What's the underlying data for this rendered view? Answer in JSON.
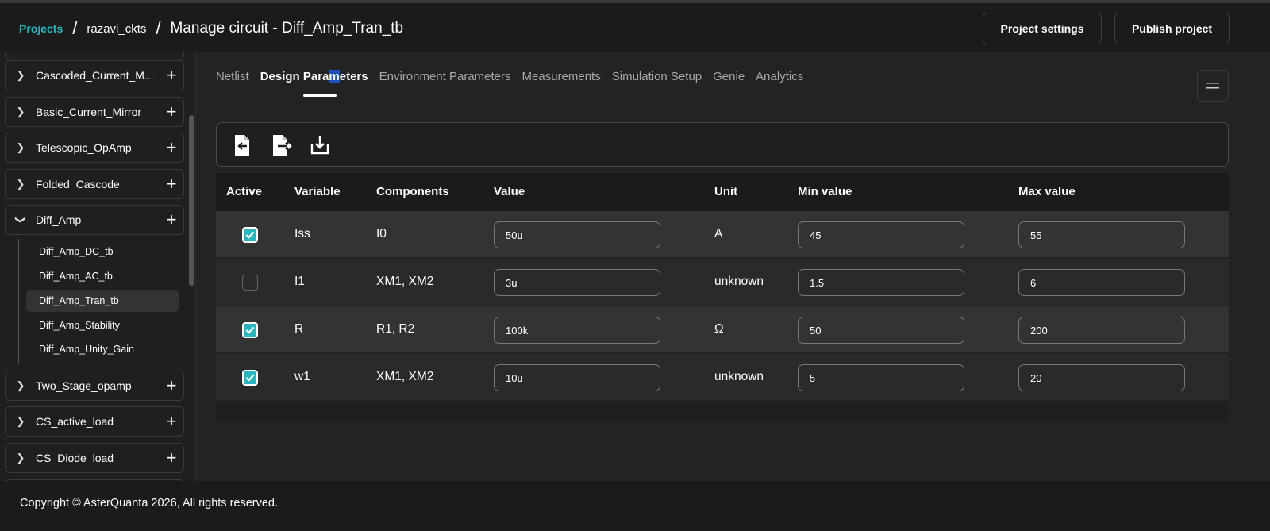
{
  "breadcrumb": {
    "projects": "Projects",
    "project": "razavi_ckts",
    "title": "Manage circuit - Diff_Amp_Tran_tb",
    "separator": "/"
  },
  "header_buttons": {
    "settings": "Project settings",
    "publish": "Publish project"
  },
  "sidebar": {
    "groups_top": [
      {
        "label": "Cascoded_Current_M..."
      },
      {
        "label": "Basic_Current_Mirror"
      },
      {
        "label": "Telescopic_OpAmp"
      },
      {
        "label": "Folded_Cascode"
      },
      {
        "label": "Diff_Amp"
      }
    ],
    "subitems": [
      {
        "label": "Diff_Amp_DC_tb"
      },
      {
        "label": "Diff_Amp_AC_tb"
      },
      {
        "label": "Diff_Amp_Tran_tb"
      },
      {
        "label": "Diff_Amp_Stability"
      },
      {
        "label": "Diff_Amp_Unity_Gain"
      }
    ],
    "groups_bottom": [
      {
        "label": "Two_Stage_opamp"
      },
      {
        "label": "CS_active_load"
      },
      {
        "label": "CS_Diode_load"
      }
    ]
  },
  "tabs": {
    "netlist": "Netlist",
    "design_a": "Design Para",
    "design_hl": "m",
    "design_b": "eters",
    "environment": "Environment Parameters",
    "measurements": "Measurements",
    "simulation": "Simulation Setup",
    "genie": "Genie",
    "analytics": "Analytics"
  },
  "table": {
    "headers": {
      "active": "Active",
      "variable": "Variable",
      "components": "Components",
      "value": "Value",
      "unit": "Unit",
      "min": "Min value",
      "max": "Max value"
    },
    "rows": [
      {
        "active": true,
        "variable": "Iss",
        "components": "I0",
        "value": "50u",
        "unit": "A",
        "min": "45",
        "max": "55"
      },
      {
        "active": false,
        "variable": "I1",
        "components": "XM1, XM2",
        "value": "3u",
        "unit": "unknown",
        "min": "1.5",
        "max": "6"
      },
      {
        "active": true,
        "variable": "R",
        "components": "R1, R2",
        "value": "100k",
        "unit": "Ω",
        "min": "50",
        "max": "200"
      },
      {
        "active": true,
        "variable": "w1",
        "components": "XM1, XM2",
        "value": "10u",
        "unit": "unknown",
        "min": "5",
        "max": "20"
      }
    ]
  },
  "footer": {
    "copyright": "Copyright © AsterQuanta 2026, All rights reserved."
  },
  "colors": {
    "accent": "#2ab6bf",
    "background": "#232323",
    "header": "#1b1b1b"
  }
}
